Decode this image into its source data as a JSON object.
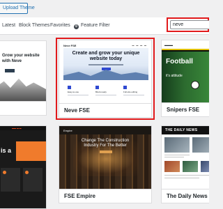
{
  "toolbar": {
    "upload_label": "Upload Theme"
  },
  "filters": {
    "tabs": [
      "Latest",
      "Block Themes",
      "Favorites"
    ],
    "feature_filter": "Feature Filter",
    "search_value": "neve"
  },
  "themes": [
    {
      "name": "",
      "preview": {
        "headline": "Grow your website with Neve"
      }
    },
    {
      "name": "Neve FSE",
      "preview": {
        "logo": "Neve FSE",
        "headline": "Create and grow your unique website today",
        "features": [
          "Easy-to-use",
          "Block-ready",
          "Full-site editing"
        ]
      }
    },
    {
      "name": "Snipers FSE",
      "preview": {
        "headline": "Football",
        "subline": "it's attitude"
      }
    },
    {
      "name": "",
      "preview": {
        "headline": "is a"
      }
    },
    {
      "name": "FSE Empire",
      "preview": {
        "logo": "Empire",
        "headline": "Change The Construction Industry For The Better"
      }
    },
    {
      "name": "The Daily News",
      "preview": {
        "logo": "THE DAILY NEWS"
      }
    }
  ],
  "colors": {
    "highlight": "#e1191b",
    "wp_blue": "#2271b1",
    "accent_orange": "#f07b2c",
    "neve_blue": "#2f49d1"
  }
}
